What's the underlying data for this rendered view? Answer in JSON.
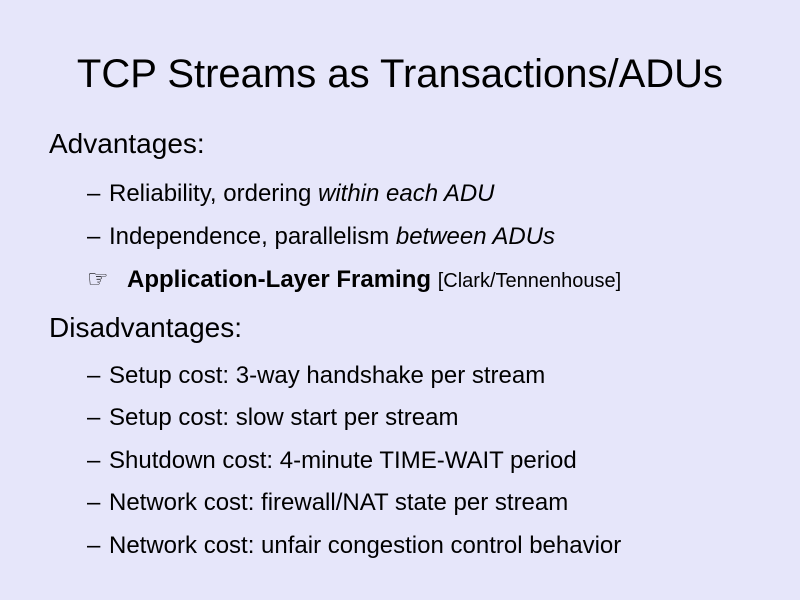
{
  "slide": {
    "title": "TCP Streams as Transactions/ADUs",
    "advantages": {
      "heading": "Advantages:",
      "items": [
        {
          "dash": "–",
          "text": "Reliability, ordering ",
          "emphasis": "within each ADU"
        },
        {
          "dash": "–",
          "text": "Independence, parallelism ",
          "emphasis": "between ADUs"
        }
      ],
      "highlight": {
        "icon": "pointing-hand-icon",
        "glyph": "☞",
        "text": "Application-Layer Framing",
        "citation": "[Clark/Tennenhouse]"
      }
    },
    "disadvantages": {
      "heading": "Disadvantages:",
      "items": [
        {
          "dash": "–",
          "text": "Setup cost: 3-way handshake per stream"
        },
        {
          "dash": "–",
          "text": "Setup cost: slow start per stream"
        },
        {
          "dash": "–",
          "text": "Shutdown cost: 4-minute TIME-WAIT period"
        },
        {
          "dash": "–",
          "text": "Network cost: firewall/NAT state per stream"
        },
        {
          "dash": "–",
          "text": "Network cost: unfair congestion control behavior"
        }
      ]
    }
  },
  "colors": {
    "background": "#e6e6fa",
    "text": "#000000"
  }
}
